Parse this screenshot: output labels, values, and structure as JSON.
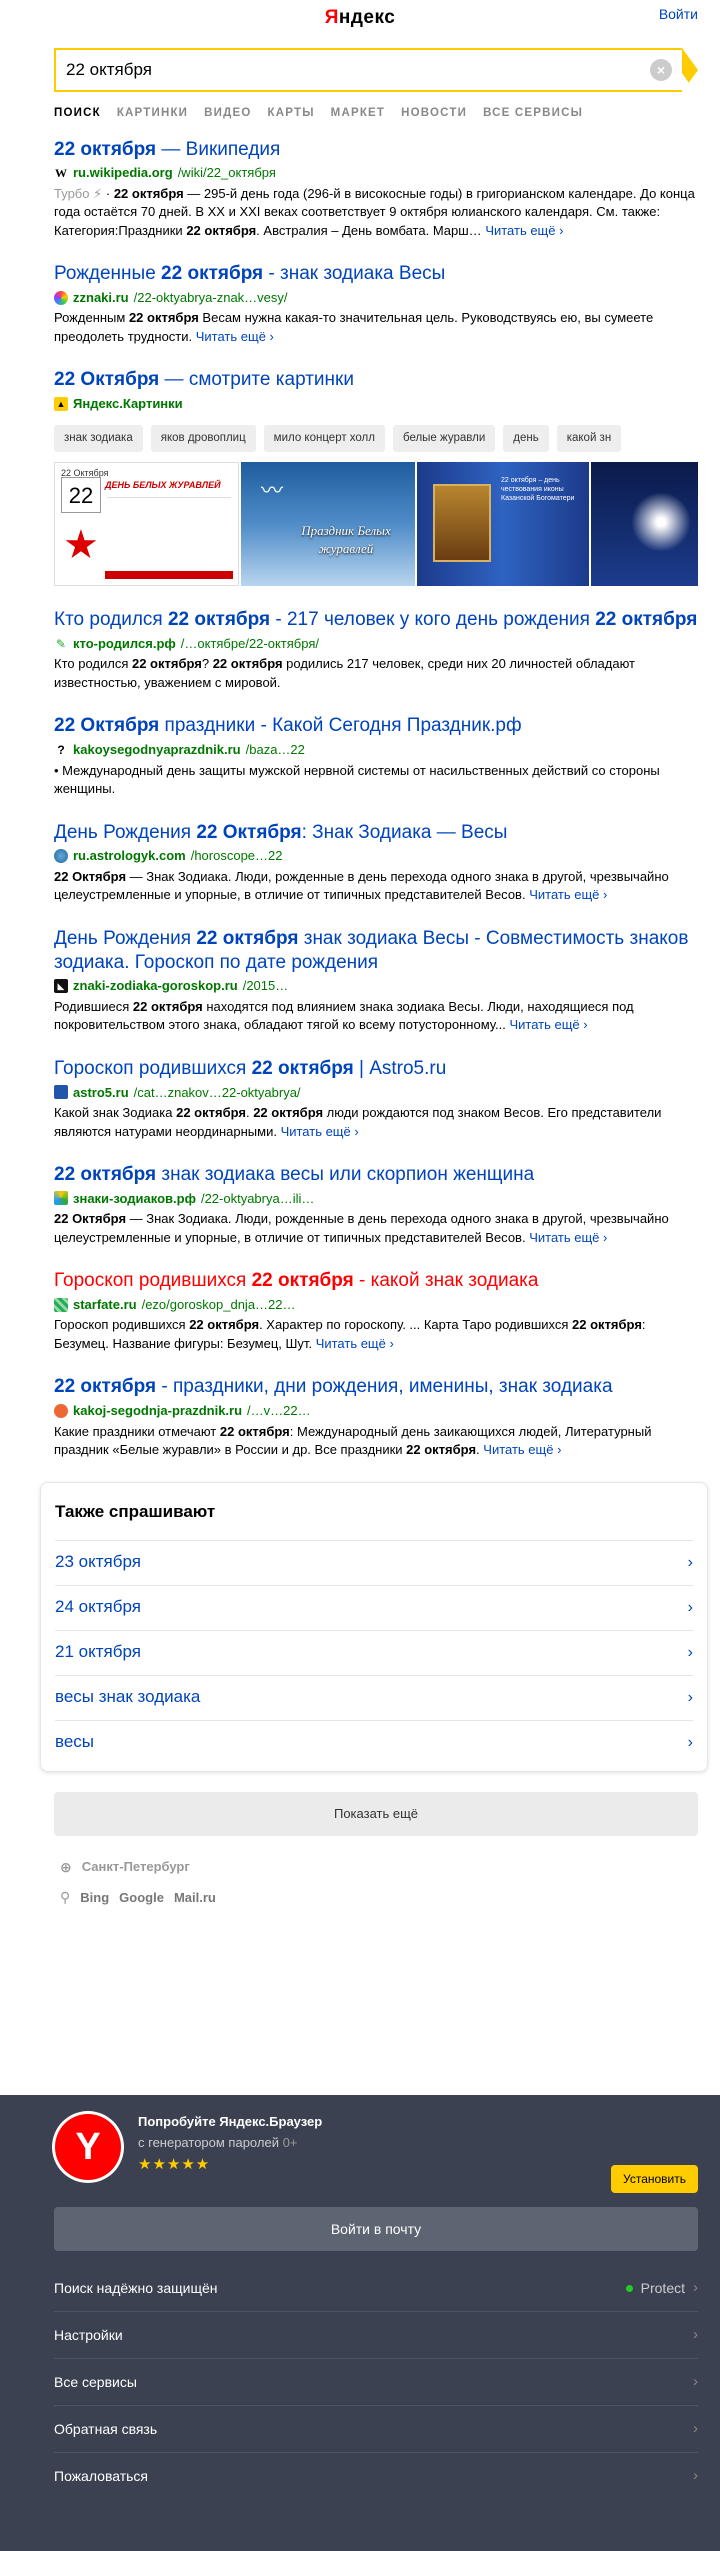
{
  "header": {
    "logo": "Яндекс",
    "login": "Войти"
  },
  "search": {
    "value": "22 октября",
    "clear": "×"
  },
  "tabs": [
    "Поиск",
    "Картинки",
    "Видео",
    "Карты",
    "Маркет",
    "Новости",
    "Все сервисы"
  ],
  "results": [
    {
      "title_pre": "",
      "title_bold": "22 октября",
      "title_post": " — Википедия",
      "url_bold": "ru.wikipedia.org",
      "url_rest": "/wiki/22_октября",
      "favicon": "W",
      "turbo": "Турбо",
      "text": "· 22 октября — 295-й день года (296-й в високосные годы) в григорианском календаре. До конца года остаётся 70 дней. В XX и XXI веках соответствует 9 октября юлианского календаря. См. также: Категория:Праздники 22 октября. Австралия – День вомбата. Марш…",
      "more": "Читать ещё ›"
    },
    {
      "title_pre": "Рожденные ",
      "title_bold": "22 октября",
      "title_post": " - знак зодиака Весы",
      "url_bold": "zznaki.ru",
      "url_rest": "/22-oktyabrya-znak…vesy/",
      "favicon": "",
      "text": "Рожденным 22 октября Весам нужна какая-то значительная цель. Руководствуясь ею, вы сумеете преодолеть трудности.",
      "more": "Читать ещё ›"
    }
  ],
  "images": {
    "title_bold": "22 Октября",
    "title_post": " — смотрите картинки",
    "source": "Яндекс.Картинки",
    "chips": [
      "знак зодиака",
      "яков дровоплиц",
      "мило концерт холл",
      "белые журавли",
      "день",
      "какой зн"
    ],
    "tile1_head": "22 Октября",
    "tile1_title": "ДЕНЬ БЕЛЫХ ЖУРАВЛЕЙ",
    "tile2_text": "Праздник Белых журавлей",
    "tile3_text": "22 октября – день чествования иконы Казанской Богоматери"
  },
  "results2": [
    {
      "title_pre": "Кто родился ",
      "title_bold": "22 октября",
      "title_post": " - 217 человек у кого день рождения ",
      "title_bold2": "22 октября",
      "url_bold": "кто-родился.рф",
      "url_rest": "/…oктябре/22-oктября/",
      "text": "Кто родился 22 октября? 22 октября родились 217 человек, среди них 20 личностей обладают известностью, уважением с мировой.",
      "more": "Читать ещё ›"
    },
    {
      "title_pre": "",
      "title_bold": "22 Октября",
      "title_post": " праздники - Какой Сегодня Праздник.рф",
      "url_bold": "kakoysegodnyaprazdnik.ru",
      "url_rest": "/baza…22",
      "text": "• Международный день защиты мужской нервной системы от насильственных действий со стороны женщины.",
      "more": ""
    },
    {
      "title_pre": "День Рождения ",
      "title_bold": "22 Октября",
      "title_post": ": Знак Зодиака — Весы",
      "url_bold": "ru.astrologyk.com",
      "url_rest": "/horoscope…22",
      "text": "22 Октября — Знак Зодиака. Люди, рожденные в день перехода одного знака в другой, чрезвычайно целеустремленные и упорные, в отличие от типичных представителей Весов.",
      "more": "Читать ещё ›"
    },
    {
      "title_pre": "День Рождения ",
      "title_bold": "22 октября",
      "title_post": " знак зодиака Весы - Совместимость знаков зодиака. Гороскоп по дате рождения",
      "url_bold": "znaki-zodiaka-goroskop.ru",
      "url_rest": "/2015…",
      "text": "Родившиеся 22 октября находятся под влиянием знака зодиака Весы. Люди, находящиеся под покровительством этого знака, обладают тягой ко всему потусторонному...",
      "more": "Читать ещё ›"
    },
    {
      "title_pre": "Гороскоп родившихся ",
      "title_bold": "22 октября",
      "title_post": " | Astro5.ru",
      "url_bold": "astro5.ru",
      "url_rest": "/cat…znakov…22-oktyabrya/",
      "text": "Какой знак Зодиака 22 октября. 22 октября люди рождаются под знаком Весов. Его представители являются натурами неординарными.",
      "more": "Читать ещё ›"
    },
    {
      "title_pre": "",
      "title_bold": "22 октября",
      "title_post": " знак зодиака весы или скорпион женщина",
      "url_bold": "знаки-зодиаков.рф",
      "url_rest": "/22-oktyabrya…ili…",
      "text": "22 Октября — Знак Зодиака. Люди, рожденные в день перехода одного знака в другой, чрезвычайно целеустремленные и упорные, в отличие от типичных представителей Весов.",
      "more": "Читать ещё ›"
    },
    {
      "title_pre": "Гороскоп родившихся ",
      "title_bold": "22 октября",
      "title_post": " - какой знак зодиака",
      "url_bold": "starfate.ru",
      "url_rest": "/ezo/goroskop_dnja…22…",
      "text": "Гороскоп родившихся 22 октября. Характер по гороскопу. ... Карта Таро родившихся 22 октября: Безумец. Название фигуры: Безумец, Шут.",
      "more": "Читать ещё ›"
    },
    {
      "title_pre": "",
      "title_bold": "22 октября",
      "title_post": " - праздники, дни рождения, именины, знак зодиака",
      "url_bold": "kakoj-segodnja-prazdnik.ru",
      "url_rest": "/…v…22…",
      "text": "Какие праздники отмечают 22 октября: Международный день заикающихся людей, Литературный праздник «Белые журавли» в России и др. Все праздники 22 октября.",
      "more": "Читать ещё ›"
    }
  ],
  "paa": {
    "title": "Также спрашивают",
    "items": [
      "23 октября",
      "24 октября",
      "21 октября",
      "весы знак зодиака",
      "весы"
    ]
  },
  "show_more": "Показать ещё",
  "region": "Санкт-Петербург",
  "engines": [
    "Bing",
    "Google",
    "Mail.ru"
  ],
  "footer": {
    "promo_title": "Попробуйте Яндекс.Браузер",
    "promo_sub": "с генератором паролей",
    "age": "0+",
    "stars": "★★★★★",
    "install": "Установить",
    "login_button": "Войти в почту",
    "items": [
      {
        "label": "Поиск надёжно защищён",
        "right": "Protect"
      },
      {
        "label": "Настройки",
        "right": ""
      },
      {
        "label": "Все сервисы",
        "right": ""
      },
      {
        "label": "Обратная связь",
        "right": ""
      },
      {
        "label": "Пожаловаться",
        "right": ""
      }
    ]
  },
  "colors": {
    "link": "#0044bb",
    "url_green": "#007700",
    "accent": "#ffcc00",
    "footer_bg": "#3b4151",
    "ya_red": "#ff0000"
  }
}
